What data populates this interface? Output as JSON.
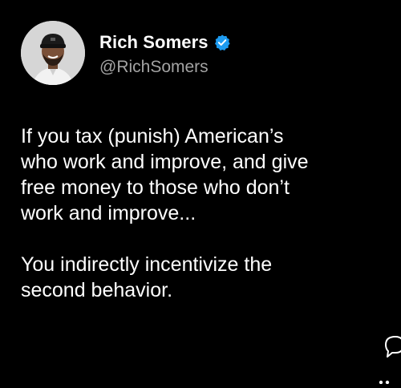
{
  "author": {
    "display_name": "Rich Somers",
    "handle": "@RichSomers",
    "verified": true,
    "verified_icon": "verified-badge-icon",
    "verified_color": "#1d9bf0",
    "avatar_icon": "profile-photo"
  },
  "tweet": {
    "paragraph_1_lines": [
      "If you tax (punish) American’s",
      "who work and improve, and give",
      "free money to those who don’t",
      "work and improve..."
    ],
    "paragraph_2_lines": [
      "You indirectly incentivize the",
      "second behavior."
    ]
  },
  "actions": {
    "reply_icon": "speech-bubble-icon"
  },
  "colors": {
    "background": "#000000",
    "text": "#ffffff",
    "secondary_text": "#a3a3a3"
  }
}
